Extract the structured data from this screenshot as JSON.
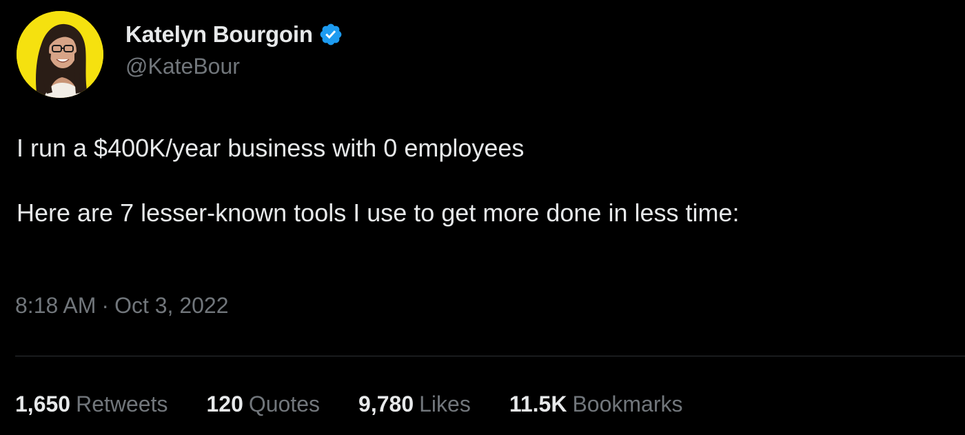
{
  "author": {
    "display_name": "Katelyn Bourgoin",
    "handle": "@KateBour",
    "verified": true,
    "avatar_bg": "#f5e10f",
    "verified_color": "#1d9bf0"
  },
  "tweet": {
    "paragraphs": [
      "I run a $400K/year business with 0 employees",
      "Here are 7 lesser-known tools I use to get more done in less time:"
    ],
    "time": "8:18 AM",
    "separator": "·",
    "date": "Oct 3, 2022"
  },
  "stats": [
    {
      "value": "1,650",
      "label": "Retweets"
    },
    {
      "value": "120",
      "label": "Quotes"
    },
    {
      "value": "9,780",
      "label": "Likes"
    },
    {
      "value": "11.5K",
      "label": "Bookmarks"
    }
  ],
  "colors": {
    "background": "#000000",
    "primary_text": "#e7e9ea",
    "secondary_text": "#71767b",
    "divider": "#2f3336"
  },
  "icons": [
    "verified-badge-icon"
  ]
}
